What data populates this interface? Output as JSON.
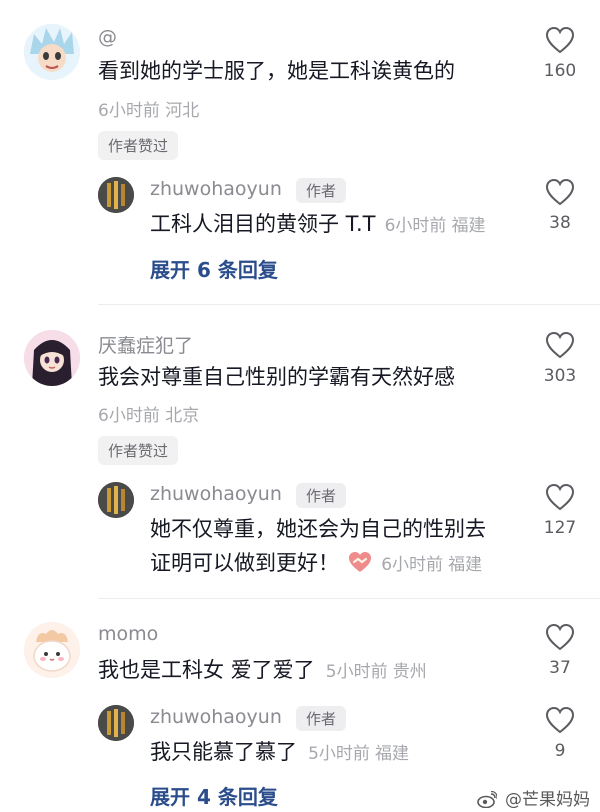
{
  "comments": [
    {
      "username": "@",
      "text": "看到她的学士服了，她是工科诶黄色的",
      "time": "6小时前",
      "location": "河北",
      "badge": "作者赞过",
      "likes": "160",
      "reply": {
        "username": "zhuwohaoyun",
        "tag": "作者",
        "text": "工科人泪目的黄领子 T.T",
        "time": "6小时前",
        "location": "福建",
        "likes": "38"
      },
      "expand": "展开 6 条回复"
    },
    {
      "username": "厌蠢症犯了",
      "text": "我会对尊重自己性别的学霸有天然好感",
      "time": "6小时前",
      "location": "北京",
      "badge": "作者赞过",
      "likes": "303",
      "reply": {
        "username": "zhuwohaoyun",
        "tag": "作者",
        "text_line1": "她不仅尊重，她还会为自己的性别去",
        "text_line2": "证明可以做到更好！",
        "time": "6小时前",
        "location": "福建",
        "likes": "127"
      }
    },
    {
      "username": "momo",
      "text": "我也是工科女 爱了爱了",
      "time": "5小时前",
      "location": "贵州",
      "likes": "37",
      "reply": {
        "username": "zhuwohaoyun",
        "tag": "作者",
        "text": "我只能慕了慕了",
        "time": "5小时前",
        "location": "福建",
        "likes": "9"
      },
      "expand": "展开 4 条回复"
    }
  ],
  "watermark": "@芒果妈妈",
  "colors": {
    "username": "#8a8b91",
    "expand_link": "#2b4d8c",
    "meta": "#a7a8ad"
  }
}
